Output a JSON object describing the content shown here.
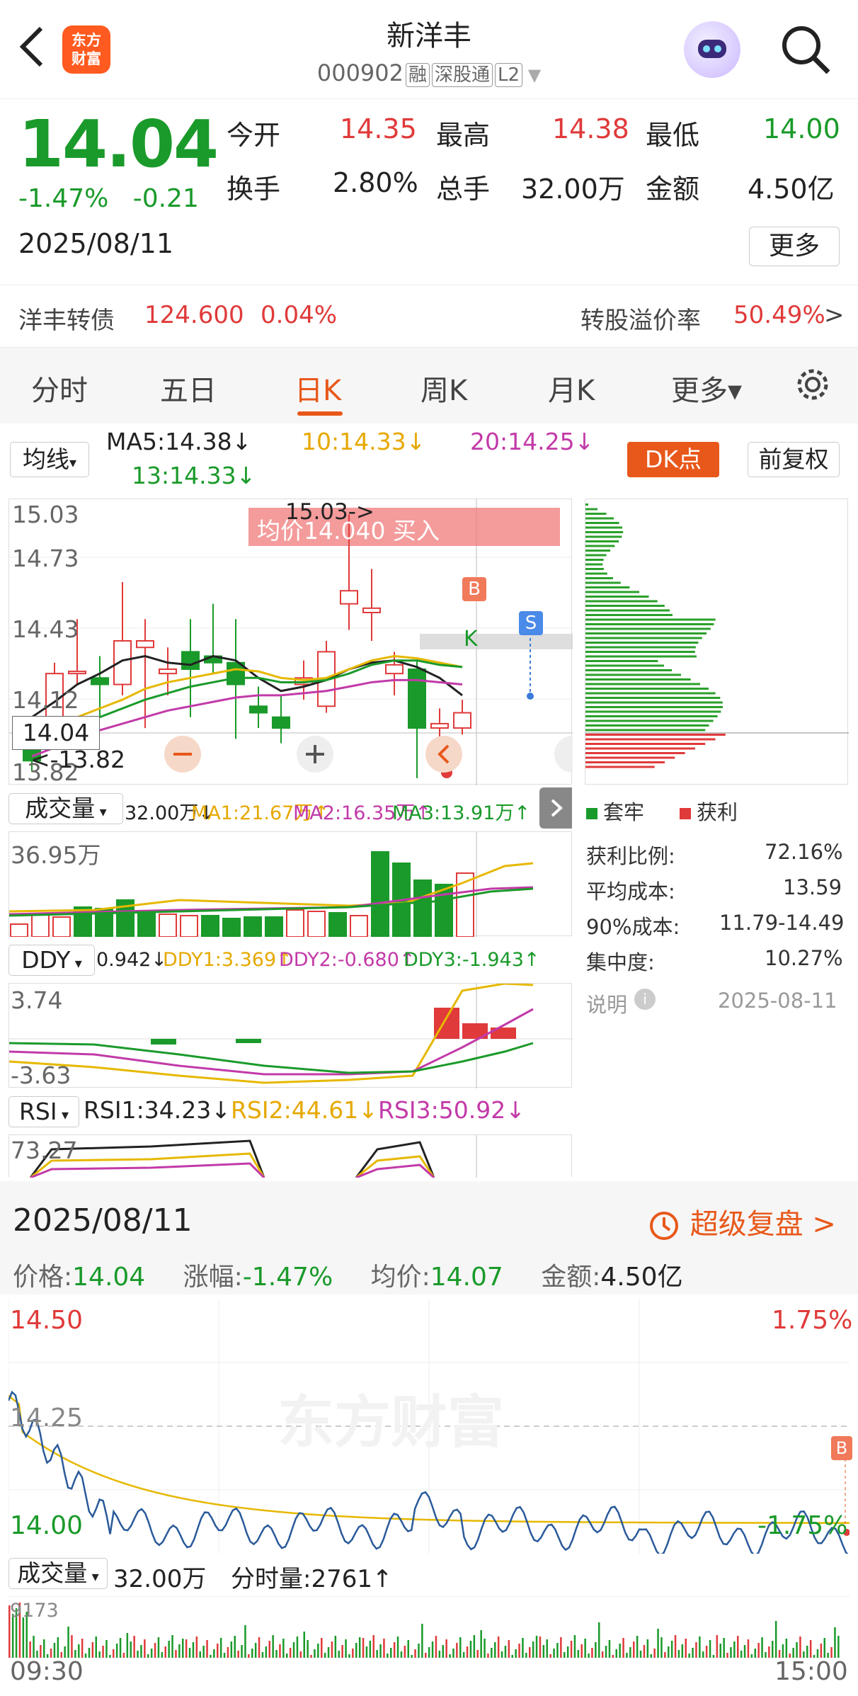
{
  "header": {
    "title": "新洋丰",
    "code": "000902",
    "tags": [
      "融",
      "深股通",
      "L2"
    ],
    "logo_text": "东方财富"
  },
  "quote": {
    "price": "14.04",
    "pct": "-1.47%",
    "chg": "-0.21",
    "date": "2025/08/11",
    "open_label": "今开",
    "open": "14.35",
    "high_label": "最高",
    "high": "14.38",
    "low_label": "最低",
    "low": "14.00",
    "turnover_label": "换手",
    "turnover": "2.80%",
    "vol_label": "总手",
    "vol": "32.00万",
    "amount_label": "金额",
    "amount": "4.50亿",
    "more": "更多"
  },
  "convertible": {
    "name": "洋丰转债",
    "price": "124.600",
    "pct": "0.04%",
    "premium_label": "转股溢价率",
    "premium": "50.49%",
    "arrow": ">"
  },
  "tabs": [
    "分时",
    "五日",
    "日K",
    "周K",
    "月K",
    "更多▾"
  ],
  "ma": {
    "selector": "均线",
    "ma5": "MA5:14.38↓",
    "ma10": "10:14.33↓",
    "ma20": "20:14.25↓",
    "ma13": "13:14.33↓",
    "dk": "DK点",
    "fq": "前复权"
  },
  "kline": {
    "y_labels": [
      "15.03",
      "14.73",
      "14.43",
      "14.12",
      "13.82"
    ],
    "high_marker": "15.03->",
    "avg_banner": "均价14.040  买入",
    "cur_price": "14.04",
    "low_marker": "<-13.82",
    "b_marker": "B",
    "s_marker": "S",
    "k_marker": "K"
  },
  "volume": {
    "selector": "成交量",
    "val": "32.00万↓",
    "ma1": "MA1:21.67万↑",
    "ma2": "MA2:16.35万↑",
    "ma3": "MA3:13.91万↑",
    "max": "36.95万"
  },
  "ddy": {
    "selector": "DDY",
    "val": "0.942↓",
    "d1": "DDY1:3.369↑",
    "d2": "DDY2:-0.680↑",
    "d3": "DDY3:-1.943↑",
    "top": "3.74",
    "bot": "-3.63"
  },
  "rsi": {
    "selector": "RSI",
    "r1": "RSI1:34.23↓",
    "r2": "RSI2:44.61↓",
    "r3": "RSI3:50.92↓",
    "top": "73.27"
  },
  "chips": {
    "legend_trap": "套牢",
    "legend_profit": "获利",
    "rows": [
      {
        "k": "获利比例:",
        "v": "72.16%"
      },
      {
        "k": "平均成本:",
        "v": "13.59"
      },
      {
        "k": "90%成本:",
        "v": "11.79-14.49"
      },
      {
        "k": "集中度:",
        "v": "10.27%"
      }
    ],
    "note": "说明",
    "note_date": "2025-08-11"
  },
  "intraday": {
    "date": "2025/08/11",
    "replay": "超级复盘 >",
    "price_label": "价格:",
    "price": "14.04",
    "pct_label": "涨幅:",
    "pct": "-1.47%",
    "avg_label": "均价:",
    "avg": "14.07",
    "amt_label": "金额:",
    "amt": "4.50亿",
    "y_top": "14.50",
    "y_mid": "14.25",
    "y_bot": "14.00",
    "p_top": "1.75%",
    "p_bot": "-1.75%",
    "b": "B",
    "vol_selector": "成交量",
    "vol": "32.00万",
    "fvol": "分时量:2761↑",
    "vmax": "9173",
    "t_start": "09:30",
    "t_end": "15:00",
    "watermark": "东方财富"
  },
  "colors": {
    "up": "#e03a3a",
    "down": "#1a9a2a",
    "accent": "#e8581a"
  }
}
